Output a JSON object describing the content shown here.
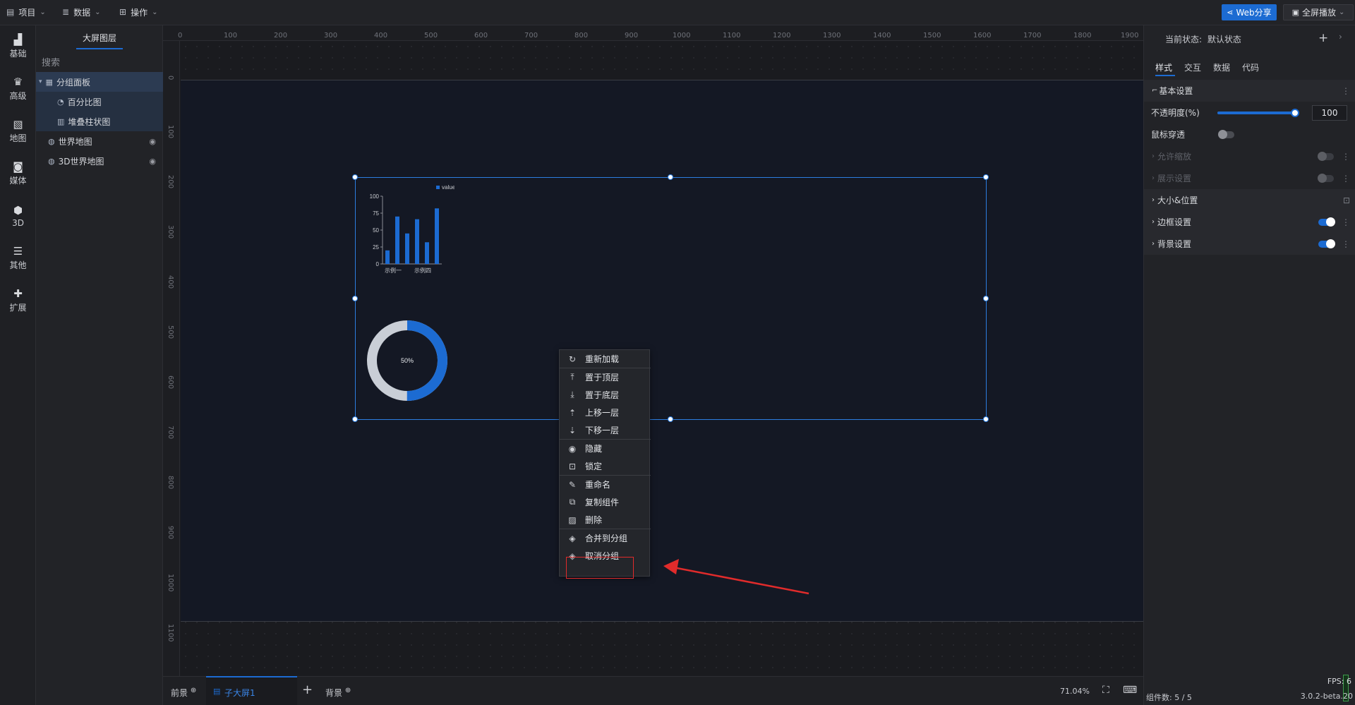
{
  "topbar": {
    "menus": [
      {
        "label": "项目",
        "icon": "file-icon"
      },
      {
        "label": "数据",
        "icon": "database-icon"
      },
      {
        "label": "操作",
        "icon": "grid-icon"
      }
    ],
    "web_share": "Web分享",
    "fullscreen": "全屏播放"
  },
  "leftnav": [
    "基础",
    "高级",
    "地图",
    "媒体",
    "3D",
    "其他",
    "扩展"
  ],
  "layers": {
    "title": "大屏图层",
    "search_placeholder": "搜索",
    "items": [
      {
        "label": "分组面板",
        "icon": "group-icon"
      },
      {
        "label": "百分比图",
        "icon": "percent-chart-icon"
      },
      {
        "label": "堆叠柱状图",
        "icon": "bar-chart-icon"
      },
      {
        "label": "世界地图",
        "icon": "globe-icon"
      },
      {
        "label": "3D世界地图",
        "icon": "globe-icon"
      }
    ]
  },
  "ruler": {
    "top": [
      "0",
      "100",
      "200",
      "300",
      "400",
      "500",
      "600",
      "700",
      "800",
      "900",
      "1000",
      "1100",
      "1200",
      "1300",
      "1400",
      "1500",
      "1600",
      "1700",
      "1800",
      "1900"
    ],
    "left": [
      "0",
      "100",
      "200",
      "300",
      "400",
      "500",
      "600",
      "700",
      "800",
      "900",
      "1000",
      "1100"
    ]
  },
  "chart_data": [
    {
      "type": "bar",
      "legend": [
        "value"
      ],
      "categories": [
        "示例一",
        "",
        "",
        "示例四",
        "",
        ""
      ],
      "values": [
        20,
        70,
        45,
        66,
        32,
        82
      ],
      "yticks": [
        "0",
        "25",
        "50",
        "75",
        "100"
      ],
      "ylim": [
        0,
        100
      ],
      "color": "#1c6bd2"
    },
    {
      "type": "pie",
      "label": "50%",
      "value": 0.5,
      "colors": [
        "#1c6bd2",
        "#c9ced6"
      ]
    }
  ],
  "context_menu": [
    {
      "label": "重新加载",
      "icon": "reload-icon"
    },
    {
      "label": "置于顶层",
      "icon": "bring-to-top-icon"
    },
    {
      "label": "置于底层",
      "icon": "send-to-bottom-icon"
    },
    {
      "label": "上移一层",
      "icon": "move-up-icon"
    },
    {
      "label": "下移一层",
      "icon": "move-down-icon"
    },
    {
      "label": "隐藏",
      "icon": "eye-icon"
    },
    {
      "label": "锁定",
      "icon": "lock-icon"
    },
    {
      "label": "重命名",
      "icon": "edit-icon"
    },
    {
      "label": "复制组件",
      "icon": "copy-icon"
    },
    {
      "label": "删除",
      "icon": "trash-icon"
    },
    {
      "label": "合并到分组",
      "icon": "layers-icon"
    },
    {
      "label": "取消分组",
      "icon": "layers-icon"
    }
  ],
  "right": {
    "state_label": "当前状态:",
    "state_value": "默认状态",
    "tabs": [
      "样式",
      "交互",
      "数据",
      "代码"
    ],
    "basic_settings": "基本设置",
    "opacity_label": "不透明度(%)",
    "opacity_value": "100",
    "opacity_level": 1.0,
    "mouse_through": "鼠标穿透",
    "allow_scale": "允许缩放",
    "display_settings": "展示设置",
    "size_position": "大小&位置",
    "border_settings": "边框设置",
    "bg_settings": "背景设置"
  },
  "bottom": {
    "foreground": "前景",
    "child_screen": "子大屏1",
    "background": "背景",
    "zoom": "71.04%",
    "fps": "FPS: 6",
    "component_count": "组件数: 5 / 5",
    "version": "3.0.2-beta.20"
  }
}
